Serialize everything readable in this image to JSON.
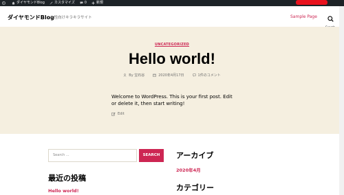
{
  "admin_bar": {
    "site_name": "ダイヤモンドBlog",
    "customize": "カスタマイズ",
    "comments_count": "0",
    "new_label": "新規"
  },
  "header": {
    "site_title": "ダイヤモンドBlog",
    "site_description": "女性向けキラキラサイト",
    "nav_link": "Sample Page",
    "search_label": "Search"
  },
  "post": {
    "category": "UNCATEGORIZED",
    "title": "Hello world!",
    "author": "By 宝石谷",
    "date": "2020年4月17日",
    "comments": "1件のコメント",
    "body": "Welcome to WordPress. This is your first post. Edit or delete it, then start writing!",
    "edit_label": "Edit"
  },
  "widgets": {
    "search_placeholder": "Search ...",
    "search_button": "SEARCH",
    "recent_posts_title": "最近の投稿",
    "recent_post_1": "Hello world!",
    "archives_title": "アーカイブ",
    "archive_1": "2020年4月",
    "categories_title": "カテゴリー"
  },
  "colors": {
    "accent": "#cd2653",
    "hero_bg": "#f5efe0",
    "admin_bar_bg": "#1d2327"
  }
}
